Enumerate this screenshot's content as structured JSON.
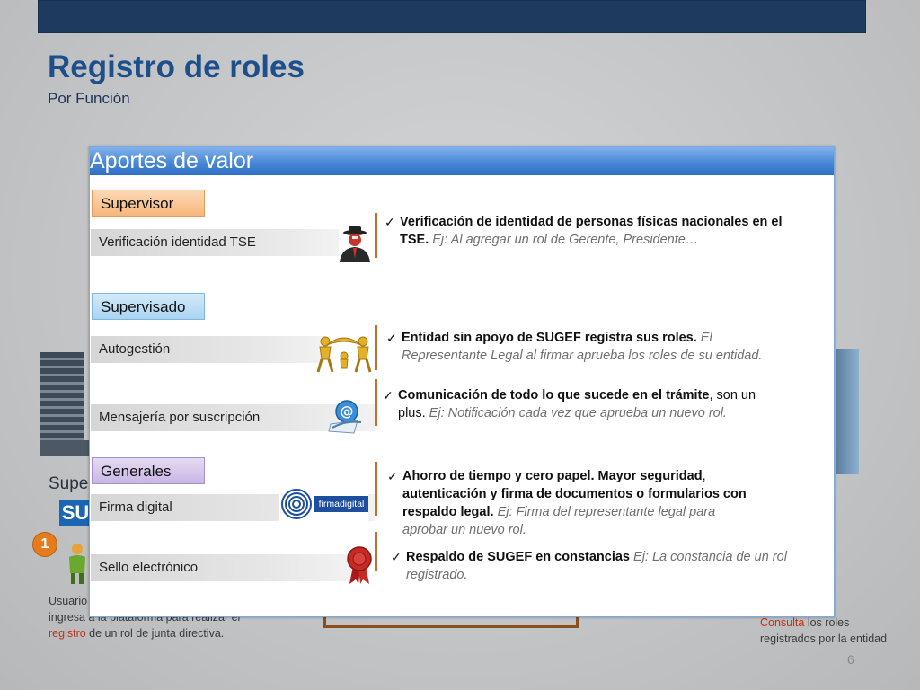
{
  "slide": {
    "title": "Registro de roles",
    "subtitle": "Por Función",
    "page_number": "6"
  },
  "background": {
    "left_label": "Super",
    "left_logo": "SU",
    "step_number": "1",
    "left_text_1": "Usuario",
    "left_text_2": "ingresa a la plataforma para realizar el",
    "left_text_highlight": "registro",
    "left_text_3": "de un rol de junta directiva.",
    "right_text_highlight": "Consulta",
    "right_text_1": "los roles",
    "right_text_2": "registrados por la entidad"
  },
  "panel": {
    "title": "Aportes de valor",
    "categories": {
      "supervisor": "Supervisor",
      "supervisado": "Supervisado",
      "generales": "Generales"
    },
    "features": {
      "tse": "Verificación identidad TSE",
      "autogestion": "Autogestión",
      "mensajeria": "Mensajería por suscripción",
      "firma": "Firma digital",
      "sello": "Sello electrónico"
    },
    "icons": {
      "tse": "spy-person-icon",
      "autogestion": "golden-figures-icon",
      "mensajeria": "email-at-icon",
      "firma": "firmadigital-logo",
      "sello": "wax-seal-icon"
    },
    "firma_logo_text": "firmadigital",
    "descriptions": {
      "tse": {
        "bold_1": "Verificación de identidad de personas físicas nacionales en el",
        "bold_2": "TSE.",
        "example": "Ej:  Al agregar un rol de Gerente, Presidente…"
      },
      "autogestion": {
        "bold": "Entidad sin apoyo de SUGEF registra sus roles.",
        "example_1": "El",
        "example_2": "Representante Legal al firmar aprueba los roles de su entidad."
      },
      "mensajeria": {
        "bold": "Comunicación de todo lo que sucede en el trámite",
        "normal_1": ",  son un",
        "normal_2": "plus.",
        "example": "Ej: Notificación cada vez que aprueba un nuevo rol."
      },
      "firma": {
        "bold_1": "Ahorro  de tiempo  y cero papel. Mayor seguridad",
        "normal_1": ",",
        "bold_2": "autenticación y firma de documentos  o formularios con",
        "bold_3": "respaldo legal.",
        "example_1": "Ej: Firma del representante legal para",
        "example_2": "aprobar un nuevo rol."
      },
      "sello": {
        "bold": "Respaldo de SUGEF en constancias",
        "example_1": "Ej: La constancia de un rol",
        "example_2": "registrado."
      }
    }
  }
}
